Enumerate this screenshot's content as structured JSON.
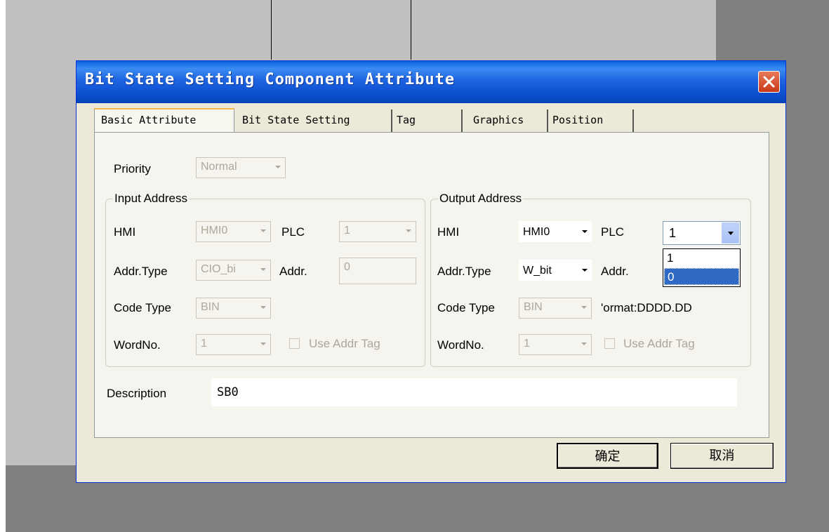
{
  "dialog": {
    "title": "Bit State Setting Component Attribute",
    "tabs": [
      "Basic Attribute",
      "Bit State Setting",
      "Tag",
      "Graphics",
      "Position"
    ],
    "active_tab": "Basic Attribute"
  },
  "priority": {
    "label": "Priority",
    "value": "Normal"
  },
  "input_address": {
    "title": "Input Address",
    "hmi_label": "HMI",
    "hmi_value": "HMI0",
    "plc_label": "PLC",
    "plc_value": "1",
    "addr_type_label": "Addr.Type",
    "addr_type_value": "CIO_bi",
    "addr_label": "Addr.",
    "addr_value": "0",
    "code_type_label": "Code Type",
    "code_type_value": "BIN",
    "word_no_label": "WordNo.",
    "word_no_value": "1",
    "use_addr_tag_label": "Use Addr Tag"
  },
  "output_address": {
    "title": "Output Address",
    "hmi_label": "HMI",
    "hmi_value": "HMI0",
    "plc_label": "PLC",
    "plc_value": "1",
    "plc_options": [
      "1",
      "0"
    ],
    "plc_highlighted": "0",
    "addr_type_label": "Addr.Type",
    "addr_type_value": "W_bit",
    "addr_label": "Addr.",
    "code_type_label": "Code Type",
    "code_type_value": "BIN",
    "format_text": "'ormat:DDDD.DD",
    "word_no_label": "WordNo.",
    "word_no_value": "1",
    "use_addr_tag_label": "Use Addr Tag"
  },
  "description": {
    "label": "Description",
    "value": "SB0"
  },
  "buttons": {
    "ok": "确定",
    "cancel": "取消"
  },
  "colors": {
    "titlebar": "#0a5fde",
    "dialog_bg": "#ece9d8",
    "selection": "#316ac5",
    "close": "#c8381a"
  }
}
